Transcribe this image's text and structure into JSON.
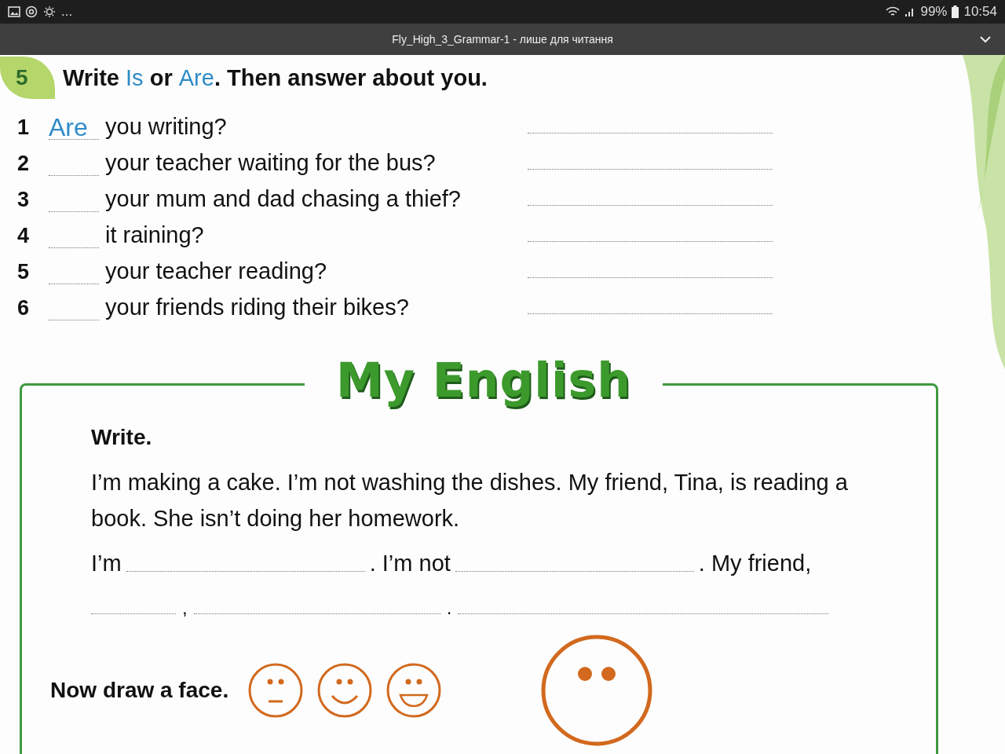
{
  "status_bar": {
    "more": "...",
    "battery": "99%",
    "time": "10:54"
  },
  "title_bar": {
    "title": "Fly_High_3_Grammar-1 - лише для читання"
  },
  "exercise": {
    "number": "5",
    "heading": [
      {
        "text": "Write ",
        "kind": "plain"
      },
      {
        "text": "Is",
        "kind": "option"
      },
      {
        "text": " or ",
        "kind": "plain"
      },
      {
        "text": "Are",
        "kind": "option"
      },
      {
        "text": ". Then answer about you.",
        "kind": "plain"
      }
    ],
    "items": [
      {
        "number": "1",
        "answer": "Are",
        "question": "you writing?"
      },
      {
        "number": "2",
        "question": "your teacher waiting for the bus?"
      },
      {
        "number": "3",
        "question": "your mum and dad chasing a thief?"
      },
      {
        "number": "4",
        "question": "it raining?"
      },
      {
        "number": "5",
        "question": "your teacher reading?"
      },
      {
        "number": "6",
        "question": "your friends riding their bikes?"
      }
    ]
  },
  "my_english": {
    "title": "My English",
    "instruction": "Write.",
    "text": "I’m making a cake. I’m not washing the dishes. My friend, Tina, is reading a book. She isn’t doing her homework.",
    "line_1": [
      "I’m",
      ". I’m not",
      ". My friend,"
    ],
    "line_2": [
      ",",
      "."
    ],
    "face_prompt": "Now draw a face.",
    "faces": [
      {
        "kind": "neutral"
      },
      {
        "kind": "smile"
      },
      {
        "kind": "grin"
      },
      {
        "kind": "blank"
      }
    ]
  }
}
